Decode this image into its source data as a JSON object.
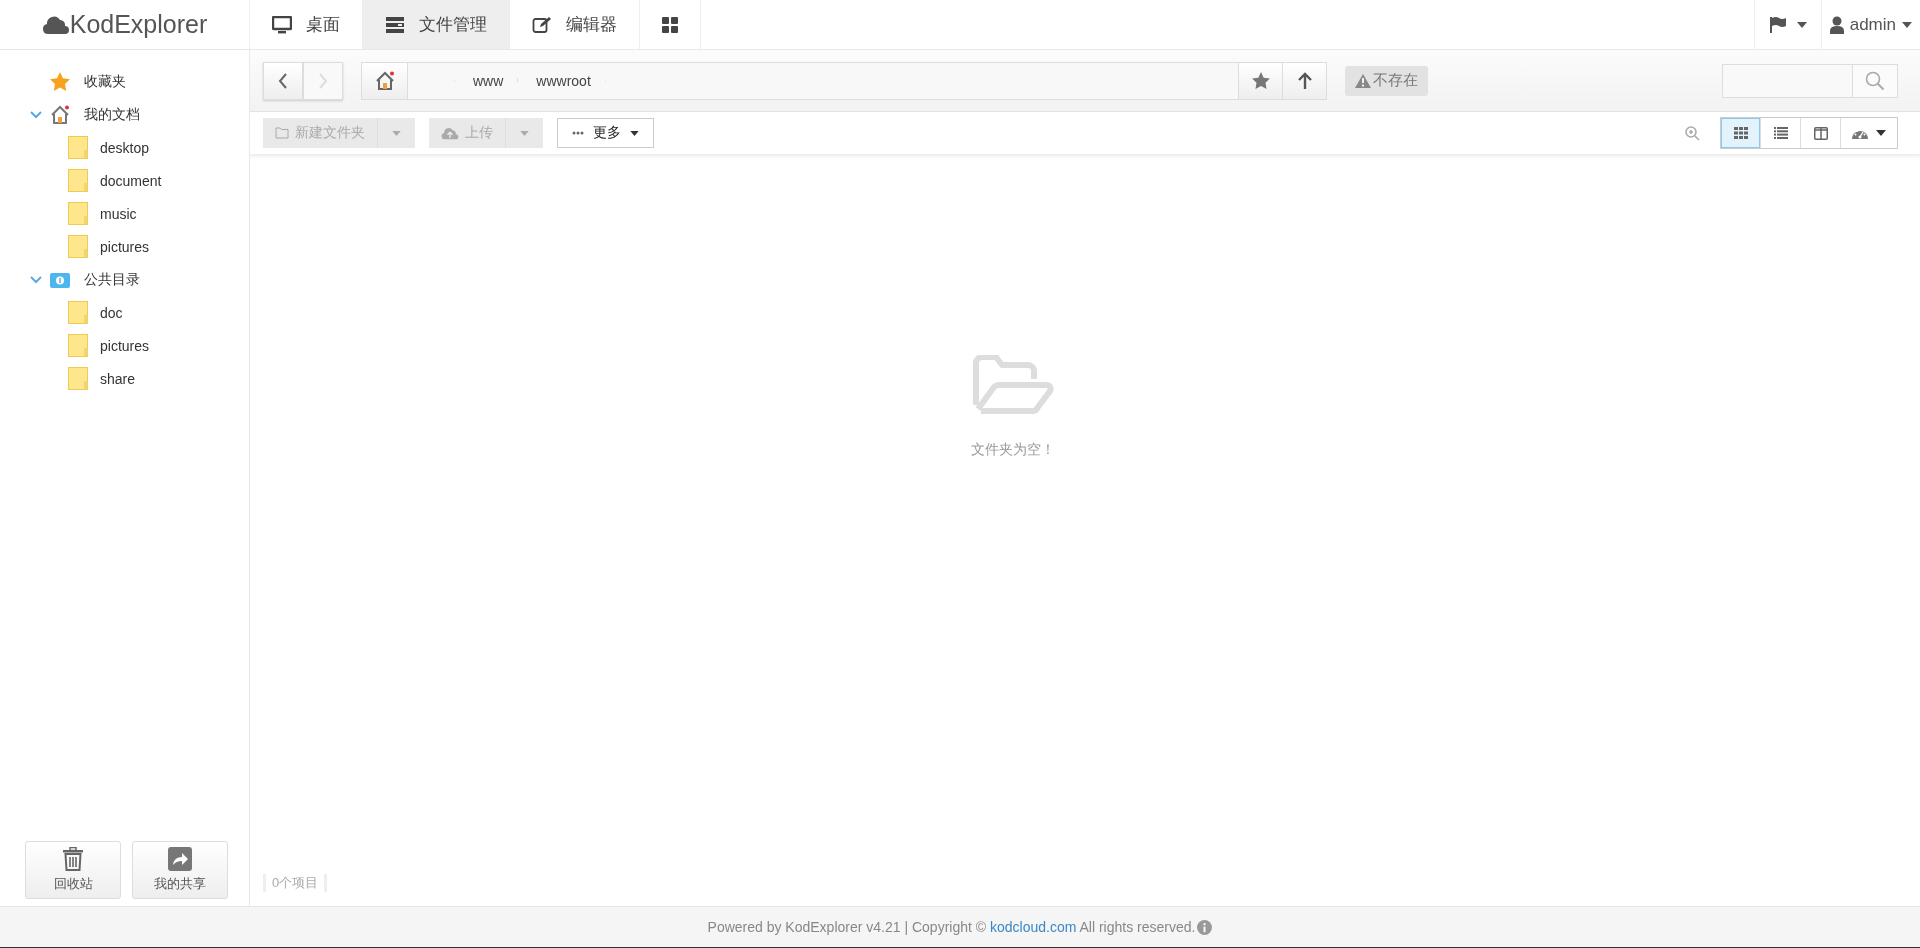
{
  "app": {
    "logo": "KodExplorer"
  },
  "nav_tabs": [
    {
      "kind": "desktop",
      "label": "桌面",
      "selected": false
    },
    {
      "kind": "files",
      "label": "文件管理",
      "selected": true
    },
    {
      "kind": "editor",
      "label": "编辑器",
      "selected": false
    },
    {
      "kind": "apps",
      "selected": false
    }
  ],
  "user": {
    "name": "admin"
  },
  "sidebar": {
    "tree": [
      {
        "kind": "favorites",
        "label": "收藏夹"
      },
      {
        "kind": "home",
        "label": "我的文档",
        "expanded": true,
        "children": [
          {
            "kind": "folder",
            "label": "desktop"
          },
          {
            "kind": "folder",
            "label": "document"
          },
          {
            "kind": "folder",
            "label": "music"
          },
          {
            "kind": "folder",
            "label": "pictures"
          }
        ]
      },
      {
        "kind": "public",
        "label": "公共目录",
        "expanded": true,
        "children": [
          {
            "kind": "folder",
            "label": "doc"
          },
          {
            "kind": "folder",
            "label": "pictures"
          },
          {
            "kind": "folder",
            "label": "share"
          }
        ]
      }
    ],
    "bottom_buttons": [
      {
        "kind": "trash",
        "label": "回收站"
      },
      {
        "kind": "share",
        "label": "我的共享"
      }
    ]
  },
  "path_bar": {
    "back_disabled": false,
    "forward_disabled": true,
    "crumbs": [
      "www",
      "wwwroot"
    ],
    "warning": "不存在"
  },
  "toolbar": {
    "new_folder": "新建文件夹",
    "upload": "上传",
    "more": "更多",
    "views": [
      {
        "kind": "grid",
        "selected": true
      },
      {
        "kind": "list",
        "selected": false
      },
      {
        "kind": "split",
        "selected": false
      }
    ]
  },
  "empty_message": "文件夹为空！",
  "status": "0个项目",
  "footer": {
    "prefix": "Powered by KodExplorer v4.21 | Copyright © ",
    "link": "kodcloud.com",
    "suffix": " All rights reserved."
  }
}
